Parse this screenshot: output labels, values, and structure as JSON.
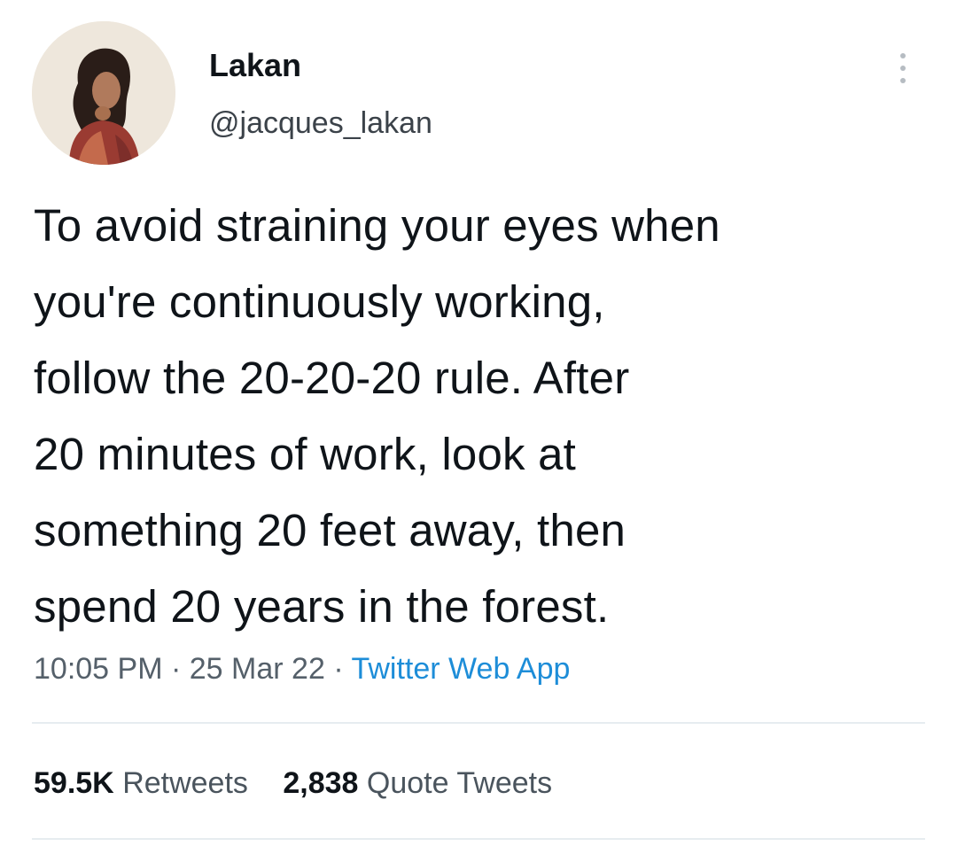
{
  "tweet": {
    "author": {
      "display_name": "Lakan",
      "handle": "@jacques_lakan"
    },
    "more_menu_icon": "more-vertical-icon",
    "text_lines": [
      "To avoid straining your eyes when",
      "you're continuously working,",
      "follow the 20-20-20 rule. After",
      "20 minutes of work, look at",
      "something 20 feet away, then",
      "spend 20 years in the forest."
    ],
    "meta": {
      "time": "10:05 PM",
      "separator": "·",
      "date": "25 Mar 22",
      "source": "Twitter Web App"
    },
    "stats": {
      "retweets_count": "59.5K",
      "retweets_label": "Retweets",
      "quotes_count": "2,838",
      "quotes_label": "Quote Tweets"
    },
    "colors": {
      "text": "#0f1419",
      "secondary_text": "#55606a",
      "link": "#1d8dd8",
      "divider": "#e6ecf0"
    }
  }
}
